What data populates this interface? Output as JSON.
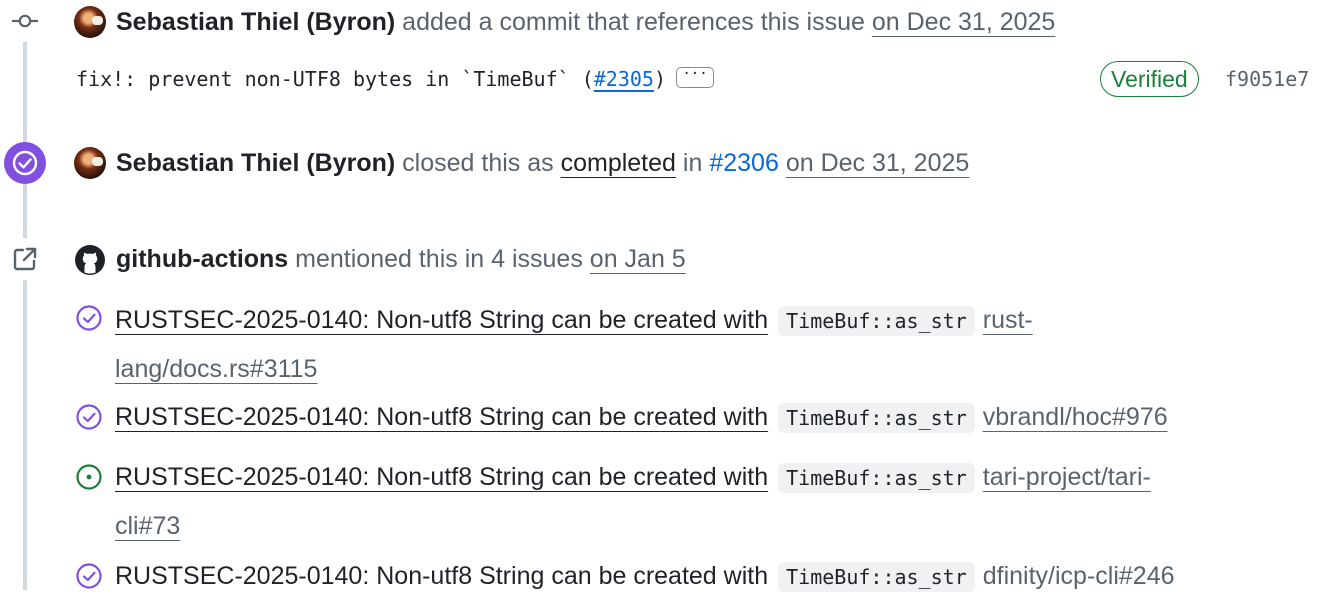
{
  "colors": {
    "closed_purple": "#8250df",
    "open_green": "#1a7f37",
    "link_blue": "#0969da",
    "muted_gray": "#59636e"
  },
  "events": {
    "commit": {
      "icon": "git-commit-icon",
      "author": "Sebastian Thiel (Byron)",
      "action": "added a commit that references this issue",
      "date": "on Dec 31, 2025",
      "message_prefix": "fix!: prevent non-UTF8 bytes in `TimeBuf` (",
      "pr_link": "#2305",
      "message_suffix": ")",
      "ellipsis": "···",
      "verified_label": "Verified",
      "sha": "f9051e7"
    },
    "closed": {
      "icon": "check-circle-icon",
      "author": "Sebastian Thiel (Byron)",
      "action": "closed this as",
      "state": "completed",
      "in_text": "in",
      "pr_ref": "#2306",
      "date": "on Dec 31, 2025"
    },
    "mention": {
      "icon": "cross-reference-icon",
      "author": "github-actions",
      "action": "mentioned this in 4 issues",
      "date": "on Jan 5"
    }
  },
  "references": [
    {
      "status": "closed",
      "status_icon": "issue-closed-icon",
      "title": "RUSTSEC-2025-0140: Non-utf8 String can be created with",
      "code": "TimeBuf::as_str",
      "repo": "rust-lang/docs.rs#3115"
    },
    {
      "status": "closed",
      "status_icon": "issue-closed-icon",
      "title": "RUSTSEC-2025-0140: Non-utf8 String can be created with",
      "code": "TimeBuf::as_str",
      "repo": "vbrandl/hoc#976"
    },
    {
      "status": "open",
      "status_icon": "issue-open-icon",
      "title": "RUSTSEC-2025-0140: Non-utf8 String can be created with",
      "code": "TimeBuf::as_str",
      "repo": "tari-project/tari-cli#73"
    },
    {
      "status": "closed",
      "status_icon": "issue-closed-icon",
      "title": "RUSTSEC-2025-0140: Non-utf8 String can be created with",
      "code": "TimeBuf::as_str",
      "repo": "dfinity/icp-cli#246"
    }
  ]
}
